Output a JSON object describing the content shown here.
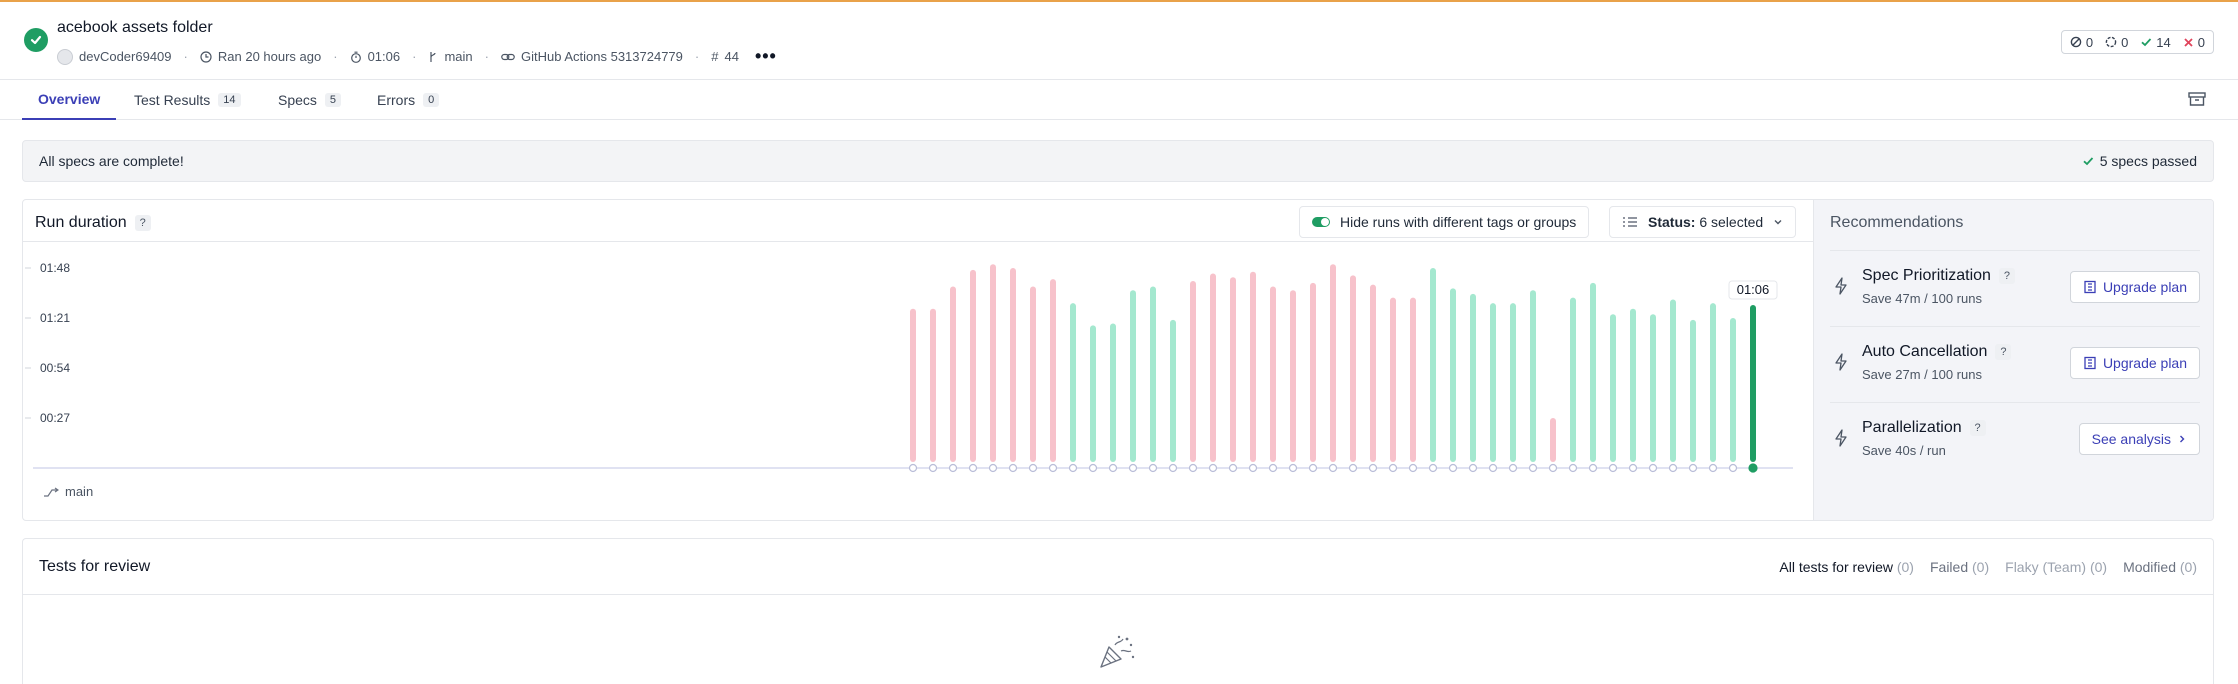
{
  "header": {
    "title": "acebook assets folder",
    "author": "devCoder69409",
    "ran": "Ran 20 hours ago",
    "duration": "01:06",
    "branch": "main",
    "ci": "GitHub Actions 5313724779",
    "run_number": "44",
    "counts": {
      "skipped": "0",
      "pending": "0",
      "passed": "14",
      "failed": "0"
    }
  },
  "tabs": [
    {
      "label": "Overview",
      "count": ""
    },
    {
      "label": "Test Results",
      "count": "14"
    },
    {
      "label": "Specs",
      "count": "5"
    },
    {
      "label": "Errors",
      "count": "0"
    }
  ],
  "banner": {
    "message": "All specs are complete!",
    "status": "5 specs passed"
  },
  "run_duration": {
    "title": "Run duration",
    "help": "?",
    "toggle_label": "Hide runs with different tags or groups",
    "status_label": "Status:",
    "status_value": "6 selected",
    "branch_label": "main"
  },
  "chart_data": {
    "type": "bar",
    "y_ticks": [
      "01:48",
      "01:21",
      "00:54",
      "00:27"
    ],
    "ylim_seconds": [
      0,
      108
    ],
    "values_seconds": [
      86,
      86,
      98,
      107,
      110,
      108,
      98,
      102,
      89,
      77,
      78,
      96,
      98,
      80,
      101,
      105,
      103,
      106,
      98,
      96,
      100,
      110,
      104,
      99,
      92,
      92,
      108,
      97,
      94,
      89,
      89,
      96,
      27,
      92,
      100,
      83,
      86,
      83,
      91,
      80,
      89,
      81,
      88
    ],
    "statuses": [
      "failed",
      "failed",
      "failed",
      "failed",
      "failed",
      "failed",
      "failed",
      "failed",
      "passed",
      "passed",
      "passed",
      "passed",
      "passed",
      "passed",
      "failed",
      "failed",
      "failed",
      "failed",
      "failed",
      "failed",
      "failed",
      "failed",
      "failed",
      "failed",
      "failed",
      "failed",
      "passed",
      "passed",
      "passed",
      "passed",
      "passed",
      "passed",
      "failed",
      "passed",
      "passed",
      "passed",
      "passed",
      "passed",
      "passed",
      "passed",
      "passed",
      "passed",
      "passed"
    ],
    "current_label": "01:06",
    "colors": {
      "failed": "#f7c2cb",
      "passed": "#a4e8cf",
      "current": "#1f9d63"
    }
  },
  "recommendations": {
    "title": "Recommendations",
    "items": [
      {
        "name": "Spec Prioritization",
        "sub": "Save 47m / 100 runs",
        "action": "Upgrade plan"
      },
      {
        "name": "Auto Cancellation",
        "sub": "Save 27m / 100 runs",
        "action": "Upgrade plan"
      },
      {
        "name": "Parallelization",
        "sub": "Save 40s / run",
        "action": "See analysis"
      }
    ]
  },
  "review": {
    "title": "Tests for review",
    "filters": [
      {
        "label": "All tests for review",
        "count": "(0)"
      },
      {
        "label": "Failed",
        "count": "(0)"
      },
      {
        "label": "Flaky (Team)",
        "count": "(0)"
      },
      {
        "label": "Modified",
        "count": "(0)"
      }
    ]
  }
}
